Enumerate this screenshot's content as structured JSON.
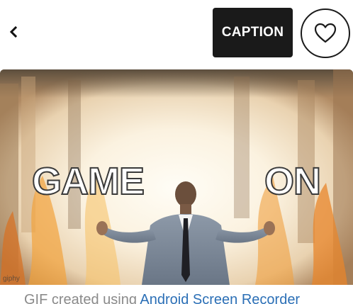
{
  "header": {
    "back_icon": "chevron-left-icon",
    "caption_label": "CAPTION",
    "favorite_icon": "heart-outline-icon"
  },
  "gif": {
    "overlay_left": "GAME",
    "overlay_right": "ON",
    "watermark": "giphy"
  },
  "footer": {
    "credit_prefix": "GIF created using ",
    "credit_link": "Android Screen Recorder"
  }
}
